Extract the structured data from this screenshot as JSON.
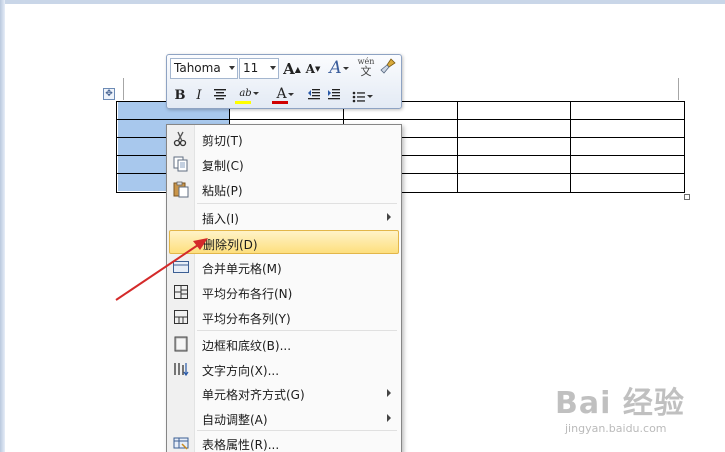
{
  "mini_toolbar": {
    "font_name": "Tahoma",
    "font_size": "11",
    "grow_font": "A",
    "shrink_font": "A",
    "styles_label": "A",
    "phonetic_label": "wén\n文",
    "format_painter_icon": "paintbrush-icon",
    "bold": "B",
    "italic": "I",
    "highlight_label": "ab",
    "font_color_label": "A"
  },
  "context_menu": {
    "items": [
      {
        "label": "剪切(T)",
        "icon": "scissors-icon"
      },
      {
        "label": "复制(C)",
        "icon": "copy-icon"
      },
      {
        "label": "粘贴(P)",
        "icon": "paste-icon"
      },
      {
        "label": "插入(I)",
        "icon": "",
        "submenu": true
      },
      {
        "label": "删除列(D)",
        "icon": "",
        "highlighted": true
      },
      {
        "label": "合并单元格(M)",
        "icon": "merge-cells-icon"
      },
      {
        "label": "平均分布各行(N)",
        "icon": "distribute-rows-icon"
      },
      {
        "label": "平均分布各列(Y)",
        "icon": "distribute-columns-icon"
      },
      {
        "label": "边框和底纹(B)...",
        "icon": "borders-icon"
      },
      {
        "label": "文字方向(X)...",
        "icon": "text-direction-icon"
      },
      {
        "label": "单元格对齐方式(G)",
        "icon": "",
        "submenu": true
      },
      {
        "label": "自动调整(A)",
        "icon": "",
        "submenu": true
      },
      {
        "label": "表格属性(R)...",
        "icon": "table-properties-icon"
      }
    ]
  },
  "watermark": {
    "logo": "Bai 经验",
    "url": "jingyan.baidu.com"
  },
  "colors": {
    "highlight_bg": "#fddf7e",
    "selection": "#a8c8ed",
    "arrow": "#d42a2a",
    "font_color_bar": "#d00000",
    "highlight_bar": "#ffff00"
  }
}
